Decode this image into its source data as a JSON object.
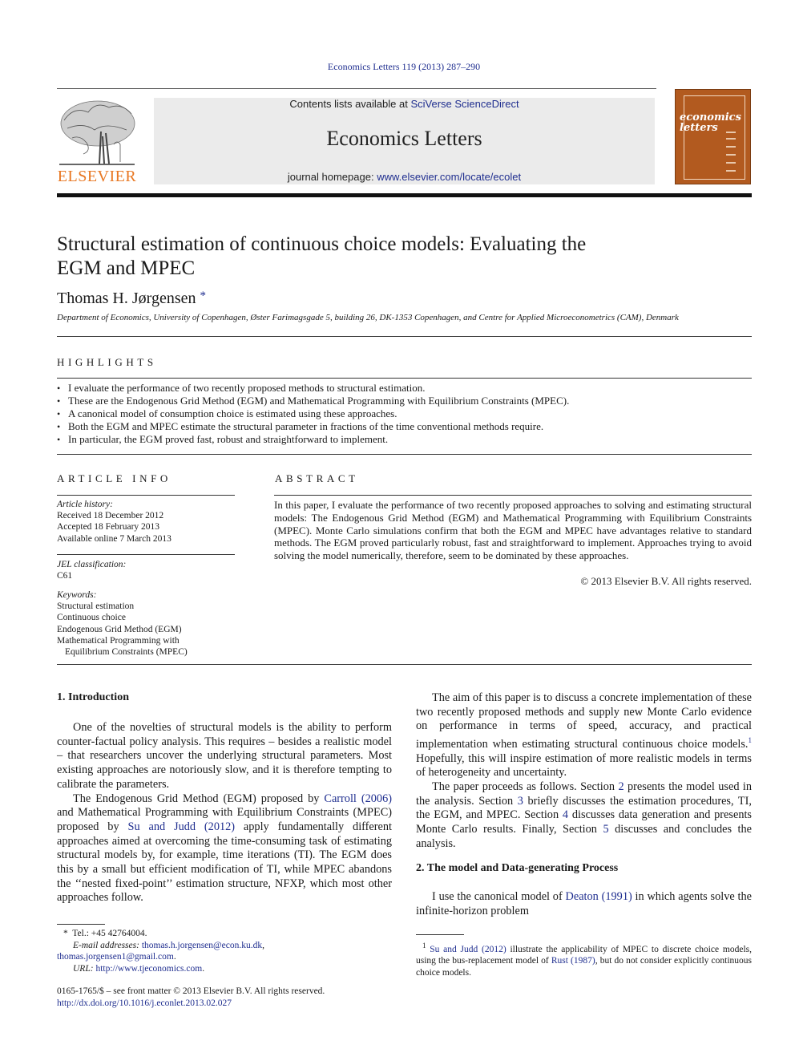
{
  "journal_ref": "Economics Letters 119 (2013) 287–290",
  "header": {
    "publisher_logo_text": "ELSEVIER",
    "contents_prefix": "Contents lists available at ",
    "contents_link": "SciVerse ScienceDirect",
    "journal_name": "Economics Letters",
    "homepage_prefix": "journal homepage: ",
    "homepage_link": "www.elsevier.com/locate/ecolet",
    "cover_title_line1": "economics",
    "cover_title_line2": "letters"
  },
  "colors": {
    "link": "#1f2e8f",
    "elsevier_orange": "#e87722",
    "cover_brown": "#b25a1f",
    "header_gray": "#ebebeb"
  },
  "article": {
    "title_line1": "Structural estimation of continuous choice models: Evaluating the",
    "title_line2": "EGM and MPEC",
    "author": "Thomas H. Jørgensen",
    "author_mark": "*",
    "affiliation": "Department of Economics, University of Copenhagen, Øster Farimagsgade 5, building 26, DK-1353 Copenhagen, and Centre for Applied Microeconometrics (CAM), Denmark"
  },
  "highlights": {
    "heading": "HIGHLIGHTS",
    "bullet": "•",
    "items": [
      "I evaluate the performance of two recently proposed methods to structural estimation.",
      "These are the Endogenous Grid Method (EGM) and Mathematical Programming with Equilibrium Constraints (MPEC).",
      "A canonical model of consumption choice is estimated using these approaches.",
      "Both the EGM and MPEC estimate the structural parameter in fractions of the time conventional methods require.",
      "In particular, the EGM proved fast, robust and straightforward to implement."
    ]
  },
  "article_info": {
    "heading": "ARTICLE INFO",
    "history_label": "Article history:",
    "received": "Received 18 December 2012",
    "accepted": "Accepted 18 February 2013",
    "online": "Available online 7 March 2013",
    "jel_label": "JEL classification:",
    "jel_code": "C61",
    "keywords_label": "Keywords:",
    "keywords": [
      "Structural estimation",
      "Continuous choice",
      "Endogenous Grid Method (EGM)",
      "Mathematical Programming with",
      "Equilibrium Constraints (MPEC)"
    ]
  },
  "abstract": {
    "heading": "ABSTRACT",
    "text": "In this paper, I evaluate the performance of two recently proposed approaches to solving and estimating structural models: The Endogenous Grid Method (EGM) and Mathematical Programming with Equilibrium Constraints (MPEC). Monte Carlo simulations confirm that both the EGM and MPEC have advantages relative to standard methods. The EGM proved particularly robust, fast and straightforward to implement. Approaches trying to avoid solving the model numerically, therefore, seem to be dominated by these approaches.",
    "copyright": "© 2013 Elsevier B.V. All rights reserved."
  },
  "intro": {
    "heading": "1.  Introduction",
    "p1": "One of the novelties of structural models is the ability to perform counter-factual policy analysis. This requires – besides a realistic model – that researchers uncover the underlying structural parameters. Most existing approaches are notoriously slow, and it is therefore tempting to calibrate the parameters.",
    "p2_a": "The Endogenous Grid Method (EGM) proposed by ",
    "p2_link1": "Carroll (2006)",
    "p2_b": " and Mathematical Programming with Equilibrium Constraints (MPEC) proposed by ",
    "p2_link2": "Su and Judd (2012)",
    "p2_c": " apply fundamentally different approaches aimed at overcoming the time-consuming task of estimating structural models by, for example, time iterations (TI). The EGM does this by a small but efficient modification of TI, while MPEC abandons the ‘‘nested fixed-point’’ estimation structure, NFXP, which most other approaches follow."
  },
  "right_col": {
    "p1_a": "The aim of this paper is to discuss a concrete implementation of these two recently proposed methods and supply new Monte Carlo evidence on performance in terms of speed, accuracy, and practical implementation when estimating structural continuous choice models.",
    "p1_fnref": "1",
    "p1_b": " Hopefully, this will inspire estimation of more realistic models in terms of heterogeneity and uncertainty.",
    "p2_a": "The paper proceeds as follows. Section ",
    "p2_s2": "2",
    "p2_b": " presents the model used in the analysis. Section ",
    "p2_s3": "3",
    "p2_c": " briefly discusses the estimation procedures, TI, the EGM, and MPEC. Section ",
    "p2_s4": "4",
    "p2_d": " discusses data generation and presents Monte Carlo results. Finally, Section ",
    "p2_s5": "5",
    "p2_e": " discusses and concludes the analysis.",
    "sec2_heading": "2.  The model and Data-generating Process",
    "sec2_a": "I use the canonical model of ",
    "sec2_link": "Deaton (1991)",
    "sec2_b": " in which agents solve the infinite-horizon problem"
  },
  "footnotes": {
    "star_mark": "*",
    "tel": "Tel.: +45 42764004.",
    "email_label": "E-mail addresses:",
    "email1": "thomas.h.jorgensen@econ.ku.dk",
    "email2": "thomas.jorgensen1@gmail.com",
    "url_label": "URL:",
    "url": "http://www.tjeconomics.com",
    "fn1_mark": "1",
    "fn1_link1": "Su and Judd (2012)",
    "fn1_a": " illustrate the applicability of MPEC to discrete choice models, using the bus-replacement model of ",
    "fn1_link2": "Rust (1987)",
    "fn1_b": ", but do not consider explicitly continuous choice models."
  },
  "front_matter": {
    "issn_line": "0165-1765/$ – see front matter © 2013 Elsevier B.V. All rights reserved.",
    "doi": "http://dx.doi.org/10.1016/j.econlet.2013.02.027"
  }
}
